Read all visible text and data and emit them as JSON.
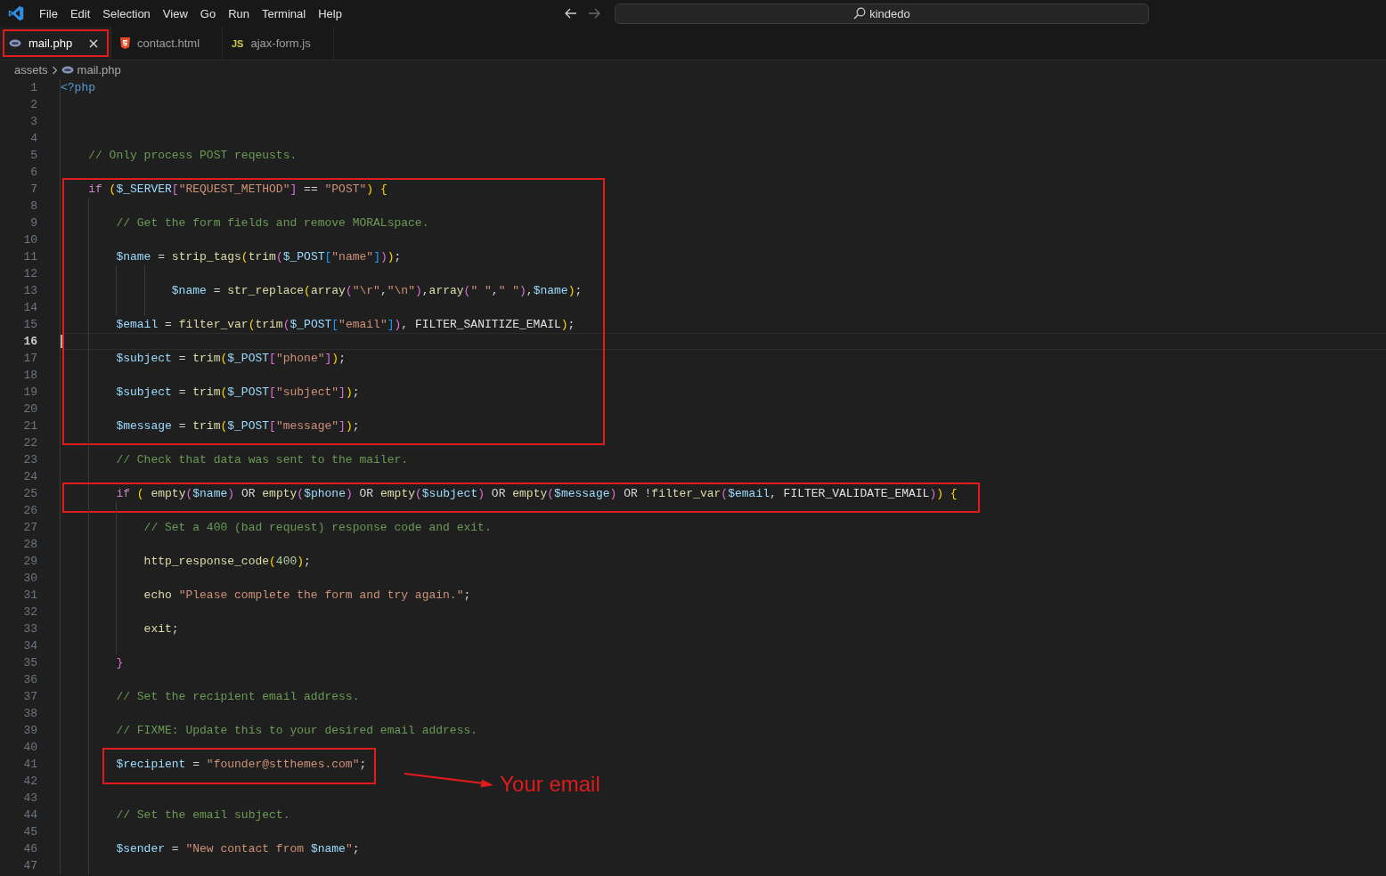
{
  "menu": [
    "File",
    "Edit",
    "Selection",
    "View",
    "Go",
    "Run",
    "Terminal",
    "Help"
  ],
  "nav": {
    "back_enabled": true,
    "forward_enabled": false
  },
  "search": {
    "value": "kindedo"
  },
  "tabs": [
    {
      "label": "mail.php",
      "kind": "php",
      "selected": true,
      "annotated": true
    },
    {
      "label": "contact.html",
      "kind": "html",
      "selected": false,
      "annotated": false
    },
    {
      "label": "ajax-form.js",
      "kind": "js",
      "icon_text": "JS",
      "selected": false,
      "annotated": false
    }
  ],
  "breadcrumb": [
    {
      "label": "assets",
      "kind": "folder"
    },
    {
      "label": "mail.php",
      "kind": "php"
    }
  ],
  "editor": {
    "blocks": [
      {
        "kind": "plain",
        "lines": [
          {
            "number": "1",
            "current": false,
            "code": [
              {
                "kind": "tag",
                "text": "<?php"
              }
            ]
          },
          {
            "number": "2",
            "current": false
          },
          {
            "number": "3",
            "current": false
          },
          {
            "number": "4",
            "current": false
          },
          {
            "number": "5",
            "current": false,
            "code": [
              {
                "kind": "com",
                "text": "    // Only process POST reqeusts."
              }
            ]
          },
          {
            "number": "6",
            "current": false
          }
        ]
      },
      {
        "kind": "line-box",
        "lines": [
          {
            "number": "7",
            "current": false,
            "code": [
              {
                "kind": "kw",
                "text": "    if "
              },
              {
                "kind": "b1",
                "text": "("
              },
              {
                "kind": "var",
                "text": "$_SERVER"
              },
              {
                "kind": "b2",
                "text": "["
              },
              {
                "kind": "str",
                "text": "\"REQUEST_METHOD\""
              },
              {
                "kind": "b2",
                "text": "]"
              },
              {
                "kind": "op",
                "text": " == "
              },
              {
                "kind": "str",
                "text": "\"POST\""
              },
              {
                "kind": "b1",
                "text": ") {"
              }
            ]
          },
          {
            "number": "8",
            "current": false
          },
          {
            "number": "9",
            "current": false,
            "code": [
              {
                "kind": "com",
                "text": "        // Get the form fields and remove MORALspace."
              }
            ]
          },
          {
            "number": "10",
            "current": false
          },
          {
            "number": "11",
            "current": false,
            "code": [
              {
                "kind": "var",
                "text": "        $name"
              },
              {
                "kind": "op",
                "text": " = "
              },
              {
                "kind": "fn",
                "text": "strip_tags"
              },
              {
                "kind": "b1",
                "text": "("
              },
              {
                "kind": "fn",
                "text": "trim"
              },
              {
                "kind": "b2",
                "text": "("
              },
              {
                "kind": "var",
                "text": "$_POST"
              },
              {
                "kind": "b3",
                "text": "["
              },
              {
                "kind": "str",
                "text": "\"name\""
              },
              {
                "kind": "b3",
                "text": "]"
              },
              {
                "kind": "b2",
                "text": ")"
              },
              {
                "kind": "b1",
                "text": ")"
              },
              {
                "kind": "op",
                "text": ";"
              }
            ]
          },
          {
            "number": "12",
            "current": false
          },
          {
            "number": "13",
            "current": false,
            "code": [
              {
                "kind": "var",
                "text": "                $name"
              },
              {
                "kind": "op",
                "text": " = "
              },
              {
                "kind": "fn",
                "text": "str_replace"
              },
              {
                "kind": "b1",
                "text": "("
              },
              {
                "kind": "fn",
                "text": "array"
              },
              {
                "kind": "b2",
                "text": "("
              },
              {
                "kind": "str",
                "text": "\"\\r\""
              },
              {
                "kind": "op",
                "text": ","
              },
              {
                "kind": "str",
                "text": "\"\\n\""
              },
              {
                "kind": "b2",
                "text": ")"
              },
              {
                "kind": "op",
                "text": ","
              },
              {
                "kind": "fn",
                "text": "array"
              },
              {
                "kind": "b2",
                "text": "("
              },
              {
                "kind": "str",
                "text": "\" \""
              },
              {
                "kind": "op",
                "text": ","
              },
              {
                "kind": "str",
                "text": "\" \""
              },
              {
                "kind": "b2",
                "text": ")"
              },
              {
                "kind": "op",
                "text": ","
              },
              {
                "kind": "var",
                "text": "$name"
              },
              {
                "kind": "b1",
                "text": ")"
              },
              {
                "kind": "op",
                "text": ";"
              }
            ]
          },
          {
            "number": "14",
            "current": false
          },
          {
            "number": "15",
            "current": false,
            "code": [
              {
                "kind": "var",
                "text": "        $email"
              },
              {
                "kind": "op",
                "text": " = "
              },
              {
                "kind": "fn",
                "text": "filter_var"
              },
              {
                "kind": "b1",
                "text": "("
              },
              {
                "kind": "fn",
                "text": "trim"
              },
              {
                "kind": "b2",
                "text": "("
              },
              {
                "kind": "var",
                "text": "$_POST"
              },
              {
                "kind": "b3",
                "text": "["
              },
              {
                "kind": "str",
                "text": "\"email\""
              },
              {
                "kind": "b3",
                "text": "]"
              },
              {
                "kind": "b2",
                "text": ")"
              },
              {
                "kind": "op",
                "text": ", "
              },
              {
                "kind": "const",
                "text": "FILTER_SANITIZE_EMAIL"
              },
              {
                "kind": "b1",
                "text": ")"
              },
              {
                "kind": "op",
                "text": ";"
              }
            ]
          },
          {
            "number": "16",
            "current": true
          },
          {
            "number": "17",
            "current": false,
            "code": [
              {
                "kind": "var",
                "text": "        $subject"
              },
              {
                "kind": "op",
                "text": " = "
              },
              {
                "kind": "fn",
                "text": "trim"
              },
              {
                "kind": "b1",
                "text": "("
              },
              {
                "kind": "var",
                "text": "$_POST"
              },
              {
                "kind": "b2",
                "text": "["
              },
              {
                "kind": "str",
                "text": "\"phone\""
              },
              {
                "kind": "b2",
                "text": "]"
              },
              {
                "kind": "b1",
                "text": ")"
              },
              {
                "kind": "op",
                "text": ";"
              }
            ]
          },
          {
            "number": "18",
            "current": false
          },
          {
            "number": "19",
            "current": false,
            "code": [
              {
                "kind": "var",
                "text": "        $subject"
              },
              {
                "kind": "op",
                "text": " = "
              },
              {
                "kind": "fn",
                "text": "trim"
              },
              {
                "kind": "b1",
                "text": "("
              },
              {
                "kind": "var",
                "text": "$_POST"
              },
              {
                "kind": "b2",
                "text": "["
              },
              {
                "kind": "str",
                "text": "\"subject\""
              },
              {
                "kind": "b2",
                "text": "]"
              },
              {
                "kind": "b1",
                "text": ")"
              },
              {
                "kind": "op",
                "text": ";"
              }
            ]
          },
          {
            "number": "20",
            "current": false
          },
          {
            "number": "21",
            "current": false,
            "code": [
              {
                "kind": "var",
                "text": "        $message"
              },
              {
                "kind": "op",
                "text": " = "
              },
              {
                "kind": "fn",
                "text": "trim"
              },
              {
                "kind": "b1",
                "text": "("
              },
              {
                "kind": "var",
                "text": "$_POST"
              },
              {
                "kind": "b2",
                "text": "["
              },
              {
                "kind": "str",
                "text": "\"message\""
              },
              {
                "kind": "b2",
                "text": "]"
              },
              {
                "kind": "b1",
                "text": ")"
              },
              {
                "kind": "op",
                "text": ";"
              }
            ]
          }
        ]
      },
      {
        "kind": "plain",
        "lines": [
          {
            "number": "22",
            "current": false
          },
          {
            "number": "23",
            "current": false,
            "code": [
              {
                "kind": "com",
                "text": "        // Check that data was sent to the mailer."
              }
            ]
          },
          {
            "number": "24",
            "current": false
          }
        ]
      },
      {
        "kind": "line-box",
        "lines": [
          {
            "number": "25",
            "current": false,
            "code": [
              {
                "kind": "kw",
                "text": "        if "
              },
              {
                "kind": "b1",
                "text": "( "
              },
              {
                "kind": "fn",
                "text": "empty"
              },
              {
                "kind": "b2",
                "text": "("
              },
              {
                "kind": "var",
                "text": "$name"
              },
              {
                "kind": "b2",
                "text": ")"
              },
              {
                "kind": "op",
                "text": " OR "
              },
              {
                "kind": "fn",
                "text": "empty"
              },
              {
                "kind": "b2",
                "text": "("
              },
              {
                "kind": "var",
                "text": "$phone"
              },
              {
                "kind": "b2",
                "text": ")"
              },
              {
                "kind": "op",
                "text": " OR "
              },
              {
                "kind": "fn",
                "text": "empty"
              },
              {
                "kind": "b2",
                "text": "("
              },
              {
                "kind": "var",
                "text": "$subject"
              },
              {
                "kind": "b2",
                "text": ")"
              },
              {
                "kind": "op",
                "text": " OR "
              },
              {
                "kind": "fn",
                "text": "empty"
              },
              {
                "kind": "b2",
                "text": "("
              },
              {
                "kind": "var",
                "text": "$message"
              },
              {
                "kind": "b2",
                "text": ")"
              },
              {
                "kind": "op",
                "text": " OR !"
              },
              {
                "kind": "fn",
                "text": "filter_var"
              },
              {
                "kind": "b2",
                "text": "("
              },
              {
                "kind": "var",
                "text": "$email"
              },
              {
                "kind": "op",
                "text": ", "
              },
              {
                "kind": "const",
                "text": "FILTER_VALIDATE_EMAIL"
              },
              {
                "kind": "b2",
                "text": ")"
              },
              {
                "kind": "b1",
                "text": ") {"
              }
            ]
          }
        ]
      },
      {
        "kind": "plain",
        "lines": [
          {
            "number": "26",
            "current": false
          },
          {
            "number": "27",
            "current": false,
            "code": [
              {
                "kind": "com",
                "text": "            // Set a 400 (bad request) response code and exit."
              }
            ]
          },
          {
            "number": "28",
            "current": false
          },
          {
            "number": "29",
            "current": false,
            "code": [
              {
                "kind": "fn",
                "text": "            http_response_code"
              },
              {
                "kind": "b1",
                "text": "("
              },
              {
                "kind": "num",
                "text": "400"
              },
              {
                "kind": "b1",
                "text": ")"
              },
              {
                "kind": "op",
                "text": ";"
              }
            ]
          },
          {
            "number": "30",
            "current": false
          },
          {
            "number": "31",
            "current": false,
            "code": [
              {
                "kind": "fn",
                "text": "            echo "
              },
              {
                "kind": "str",
                "text": "\"Please complete the form and try again.\""
              },
              {
                "kind": "op",
                "text": ";"
              }
            ]
          },
          {
            "number": "32",
            "current": false
          },
          {
            "number": "33",
            "current": false,
            "code": [
              {
                "kind": "fn",
                "text": "            exit"
              },
              {
                "kind": "op",
                "text": ";"
              }
            ]
          },
          {
            "number": "34",
            "current": false
          },
          {
            "number": "35",
            "current": false,
            "code": [
              {
                "kind": "b2",
                "text": "        }"
              }
            ]
          },
          {
            "number": "36",
            "current": false
          },
          {
            "number": "37",
            "current": false,
            "code": [
              {
                "kind": "com",
                "text": "        // Set the recipient email address."
              }
            ]
          },
          {
            "number": "38",
            "current": false
          },
          {
            "number": "39",
            "current": false,
            "code": [
              {
                "kind": "com",
                "text": "        // FIXME: Update this to your desired email address."
              }
            ]
          },
          {
            "number": "40",
            "current": false
          }
        ]
      },
      {
        "kind": "text-box",
        "note": "Your email",
        "lines": [
          {
            "number": "41",
            "current": false,
            "code": [
              {
                "kind": "var",
                "text": "        $recipient"
              },
              {
                "kind": "op",
                "text": " = "
              },
              {
                "kind": "str",
                "text": "\"founder@stthemes.com\""
              },
              {
                "kind": "op",
                "text": ";"
              }
            ]
          }
        ]
      },
      {
        "kind": "plain",
        "lines": [
          {
            "number": "42",
            "current": false
          },
          {
            "number": "43",
            "current": false
          },
          {
            "number": "44",
            "current": false,
            "code": [
              {
                "kind": "com",
                "text": "        // Set the email subject."
              }
            ]
          },
          {
            "number": "45",
            "current": false
          },
          {
            "number": "46",
            "current": false,
            "code": [
              {
                "kind": "var",
                "text": "        $sender"
              },
              {
                "kind": "op",
                "text": " = "
              },
              {
                "kind": "str",
                "text": "\"New contact from "
              },
              {
                "kind": "var",
                "text": "$name"
              },
              {
                "kind": "str",
                "text": "\""
              },
              {
                "kind": "op",
                "text": ";"
              }
            ]
          },
          {
            "number": "47",
            "current": false
          }
        ]
      }
    ]
  }
}
